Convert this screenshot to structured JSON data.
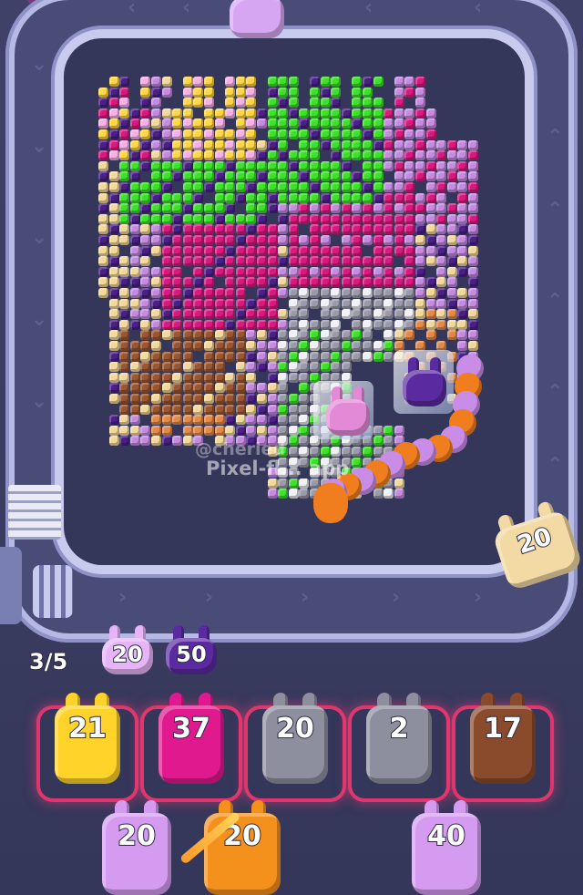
{
  "game": {
    "queue_progress": "3/5",
    "watermark_handle": "@cheried",
    "watermark_site": "Pixel-fl... app"
  },
  "conveyor_pig": {
    "value": "20",
    "color": "#f3d9a3"
  },
  "top_pig": {
    "color": "#d7a6f2"
  },
  "queue": [
    {
      "value": "20",
      "color": "#e7b4f7"
    },
    {
      "value": "50",
      "color": "#5b2aa1"
    }
  ],
  "slots": [
    {
      "value": "21",
      "color": "#ffd329"
    },
    {
      "value": "37",
      "color": "#e0198f"
    },
    {
      "value": "20",
      "color": "#8d8f9e"
    },
    {
      "value": "2",
      "color": "#8d8f9e"
    },
    {
      "value": "17",
      "color": "#8a4a2c"
    }
  ],
  "bottom_row": [
    {
      "value": "20",
      "color": "#d59bf0"
    },
    {
      "value": "20",
      "color": "#f4901c"
    },
    {
      "value": "40",
      "color": "#d59bf0"
    }
  ],
  "board_pigs": [
    {
      "name": "pink-pig",
      "color": "#e28ad6"
    },
    {
      "name": "purple-pig",
      "color": "#5a2aa0"
    }
  ],
  "palette": {
    "magenta": "#d8197f",
    "green": "#3ee12a",
    "yellow": "#ffd645",
    "pink": "#f6b0e6",
    "purple": "#4a1f86",
    "lavender": "#c48be0",
    "beige": "#f3d89c",
    "brown": "#9b5631",
    "orange": "#e38a49",
    "gray": "#9a9aab",
    "white": "#f0f0f6"
  }
}
